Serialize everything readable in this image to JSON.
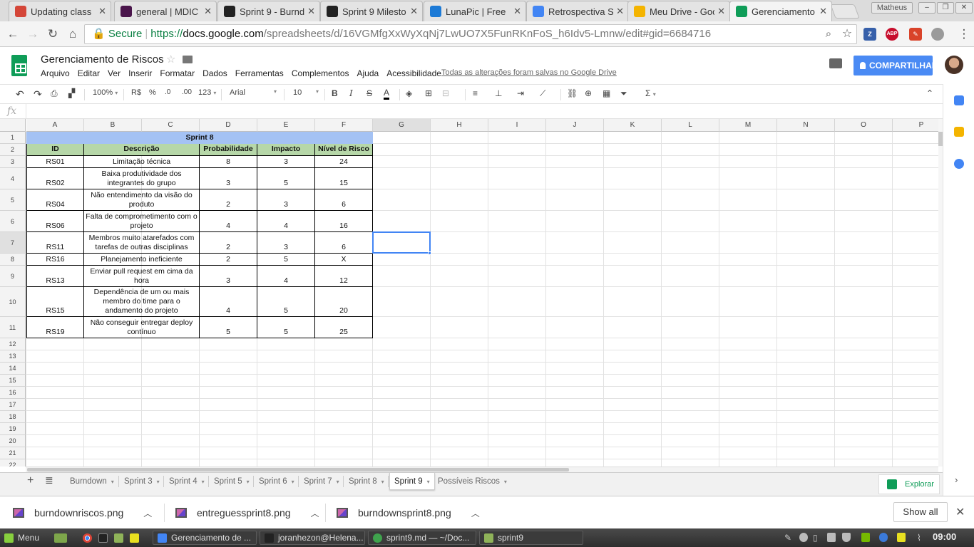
{
  "browser": {
    "tabs": [
      {
        "title": "Updating class",
        "icon": "envelope-icon",
        "color": "#d44638"
      },
      {
        "title": "general | MDIC",
        "icon": "slack-hash-icon",
        "color": "#4a154b"
      },
      {
        "title": "Sprint 9 - Burnd",
        "icon": "github-icon",
        "color": "#222222"
      },
      {
        "title": "Sprint 9 Milesto",
        "icon": "github-icon",
        "color": "#222222"
      },
      {
        "title": "LunaPic | Free",
        "icon": "lunapic-icon",
        "color": "#1c7ad6"
      },
      {
        "title": "Retrospectiva S",
        "icon": "docs-icon",
        "color": "#4285f4"
      },
      {
        "title": "Meu Drive - Goo",
        "icon": "drive-icon",
        "color": "#f4b400"
      },
      {
        "title": "Gerenciamento",
        "icon": "sheets-icon",
        "color": "#0f9d58"
      }
    ],
    "user": "Matheus",
    "secure_label": "Secure",
    "url_scheme": "https://",
    "url_host": "docs.google.com",
    "url_path": "/spreadsheets/d/16VGMfgXxWyXqNj7LwUO7X5FunRKnFoS_h6Idv5-Lmnw/edit#gid=6684716",
    "extensions": [
      {
        "name": "zotero-icon",
        "label": "Z",
        "color": "#3760aa"
      },
      {
        "name": "adblock-icon",
        "label": "ABP",
        "color": "#c70d2c"
      },
      {
        "name": "pencil-extension-icon",
        "label": "✎",
        "color": "#d9432a"
      },
      {
        "name": "grey-extension-icon",
        "label": "",
        "color": "#9a9a9a"
      }
    ]
  },
  "doc": {
    "title": "Gerenciamento de Riscos",
    "menu": [
      "Arquivo",
      "Editar",
      "Ver",
      "Inserir",
      "Formatar",
      "Dados",
      "Ferramentas",
      "Complementos",
      "Ajuda",
      "Acessibilidade"
    ],
    "saved_status": "Todas as alterações foram salvas no Google Drive",
    "share_label": "COMPARTILHAR"
  },
  "toolbar": {
    "zoom": "100%",
    "currency": "R$",
    "percent": "%",
    "dec_less": ".0",
    "dec_more": ".00",
    "more_formats": "123",
    "font": "Arial",
    "font_size": "10",
    "bold": "B",
    "italic": "I",
    "strike": "S",
    "text_color": "A",
    "sum": "Σ"
  },
  "formula_bar": {
    "fx": "fx",
    "value": ""
  },
  "grid": {
    "columns": [
      "A",
      "B",
      "C",
      "D",
      "E",
      "F",
      "G",
      "H",
      "I",
      "J",
      "K",
      "L",
      "M",
      "N",
      "O",
      "P"
    ],
    "rows": [
      "1",
      "2",
      "3",
      "4",
      "5",
      "6",
      "7",
      "8",
      "9",
      "10",
      "11",
      "12",
      "13",
      "14",
      "15",
      "16",
      "17",
      "18",
      "19",
      "20",
      "21",
      "22"
    ],
    "table_title": "Sprint 8",
    "headers": [
      "ID",
      "Descrição",
      "Probabilidade",
      "Impacto",
      "Nível de Risco"
    ],
    "data": [
      [
        "RS01",
        "Limitação técnica",
        "8",
        "3",
        "24"
      ],
      [
        "RS02",
        "Baixa produtividade dos integrantes do grupo",
        "3",
        "5",
        "15"
      ],
      [
        "RS04",
        "Não entendimento da visão do produto",
        "2",
        "3",
        "6"
      ],
      [
        "RS06",
        "Falta de comprometimento com o projeto",
        "4",
        "4",
        "16"
      ],
      [
        "RS11",
        "Membros muito atarefados com tarefas de outras disciplinas",
        "2",
        "3",
        "6"
      ],
      [
        "RS16",
        "Planejamento ineficiente",
        "2",
        "5",
        "X"
      ],
      [
        "RS13",
        "Enviar pull request em cima da hora",
        "3",
        "4",
        "12"
      ],
      [
        "RS15",
        "Dependência de um ou mais membro do time para o andamento do projeto",
        "4",
        "5",
        "20"
      ],
      [
        "RS19",
        "Não conseguir entregar deploy contínuo",
        "5",
        "5",
        "25"
      ]
    ],
    "selected_cell": "G7"
  },
  "sheets": {
    "tabs": [
      "Burndown",
      "Sprint 3",
      "Sprint 4",
      "Sprint 5",
      "Sprint 6",
      "Sprint 7",
      "Sprint 8",
      "Sprint 9",
      "Possíveis Riscos"
    ],
    "active": "Sprint 9",
    "explore_label": "Explorar"
  },
  "downloads": {
    "files": [
      "burndownriscos.png",
      "entreguessprint8.png",
      "burndownsprint8.png"
    ],
    "show_all": "Show all"
  },
  "taskbar": {
    "menu_label": "Menu",
    "windows": [
      "Gerenciamento de ...",
      "joranhezon@Helena...",
      "sprint9.md — ~/Doc...",
      "sprint9"
    ],
    "clock": "09:00"
  }
}
